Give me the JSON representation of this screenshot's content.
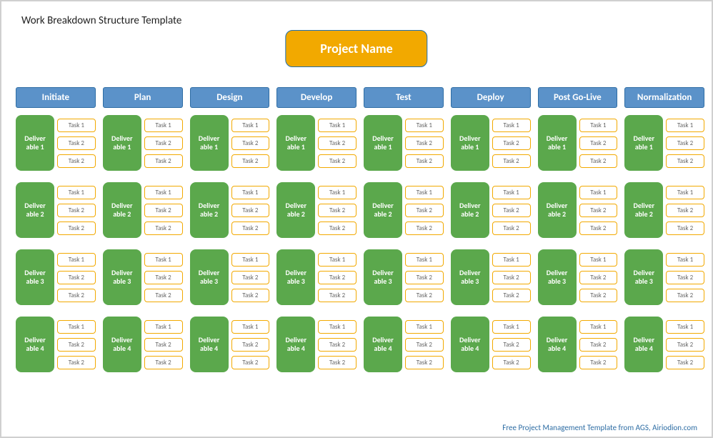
{
  "doc_title": "Work Breakdown Structure Template",
  "project_name": "Project Name",
  "phases": [
    "Initiate",
    "Plan",
    "Design",
    "Develop",
    "Test",
    "Deploy",
    "Post Go-Live",
    "Normalization"
  ],
  "deliverables": [
    "Deliver able 1",
    "Deliver able 2",
    "Deliver able 3",
    "Deliver able 4"
  ],
  "tasklabels_row1": [
    "Task 1",
    "Task 2",
    "Task 2"
  ],
  "tasklabels_other": [
    "Task 1",
    "Task 2",
    "Task 2"
  ],
  "footer": "Free Project Management Template from AGS,  Airiodion.com"
}
